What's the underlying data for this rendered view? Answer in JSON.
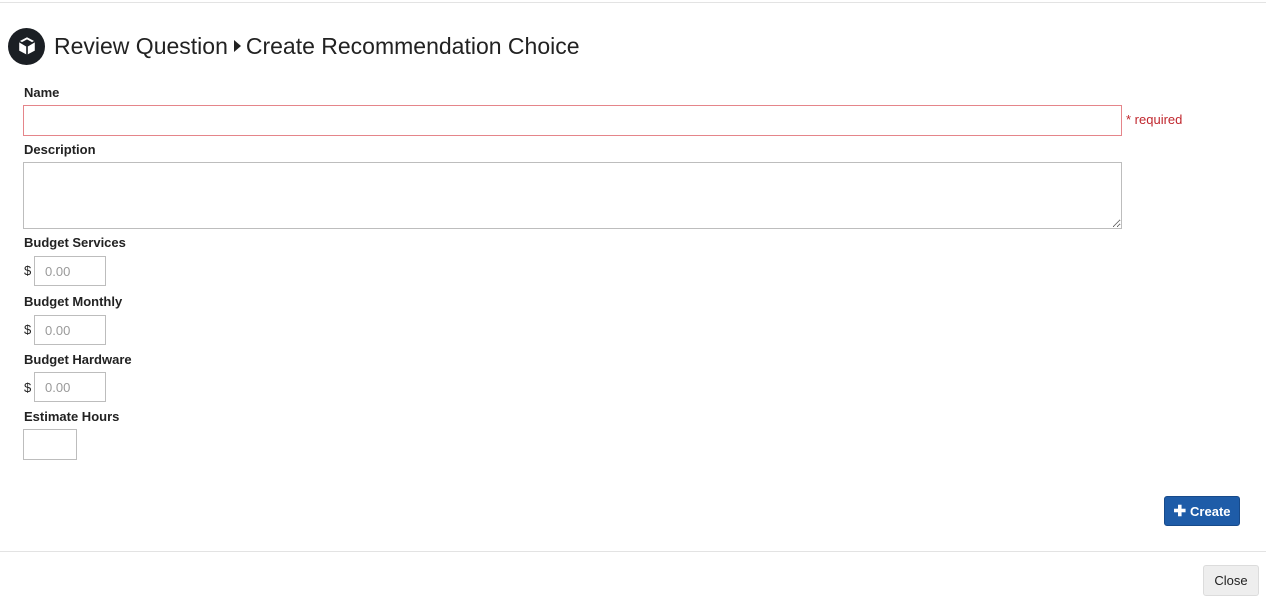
{
  "header": {
    "icon": "cube-icon",
    "breadcrumb_parent": "Review Question",
    "breadcrumb_current": "Create Recommendation Choice"
  },
  "form": {
    "name": {
      "label": "Name",
      "value": "",
      "required_note": "* required"
    },
    "description": {
      "label": "Description",
      "value": ""
    },
    "budget_services": {
      "label": "Budget Services",
      "currency": "$",
      "value": "",
      "placeholder": "0.00"
    },
    "budget_monthly": {
      "label": "Budget Monthly",
      "currency": "$",
      "value": "",
      "placeholder": "0.00"
    },
    "budget_hardware": {
      "label": "Budget Hardware",
      "currency": "$",
      "value": "",
      "placeholder": "0.00"
    },
    "estimate_hours": {
      "label": "Estimate Hours",
      "value": ""
    }
  },
  "actions": {
    "create_label": "Create",
    "create_icon": "plus-icon",
    "close_label": "Close"
  },
  "colors": {
    "primary_button": "#1e5ca8",
    "required_red": "#c0262d",
    "error_border": "#e5858a"
  }
}
